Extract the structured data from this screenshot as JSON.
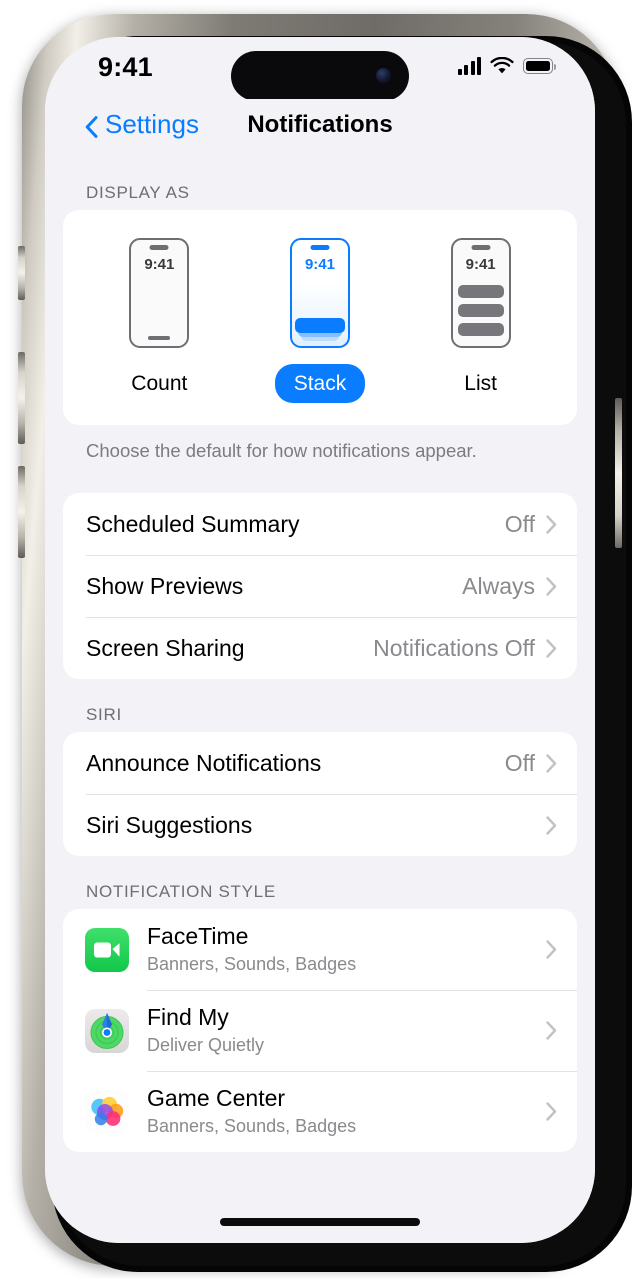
{
  "statusbar": {
    "time": "9:41",
    "cellular_icon": "cellular-signal-icon",
    "wifi_icon": "wifi-icon",
    "battery_icon": "battery-icon"
  },
  "navbar": {
    "back_label": "Settings",
    "back_icon": "chevron-left-icon",
    "title": "Notifications"
  },
  "display_as": {
    "header": "DISPLAY AS",
    "footer": "Choose the default for how notifications appear.",
    "options": [
      {
        "label": "Count",
        "preview_time": "9:41",
        "selected": false
      },
      {
        "label": "Stack",
        "preview_time": "9:41",
        "selected": true
      },
      {
        "label": "List",
        "preview_time": "9:41",
        "selected": false
      }
    ]
  },
  "general": {
    "rows": [
      {
        "label": "Scheduled Summary",
        "value": "Off"
      },
      {
        "label": "Show Previews",
        "value": "Always"
      },
      {
        "label": "Screen Sharing",
        "value": "Notifications Off"
      }
    ]
  },
  "siri": {
    "header": "SIRI",
    "rows": [
      {
        "label": "Announce Notifications",
        "value": "Off"
      },
      {
        "label": "Siri Suggestions",
        "value": ""
      }
    ]
  },
  "notification_style": {
    "header": "NOTIFICATION STYLE",
    "apps": [
      {
        "name": "FaceTime",
        "detail": "Banners, Sounds, Badges",
        "icon": "facetime-icon"
      },
      {
        "name": "Find My",
        "detail": "Deliver Quietly",
        "icon": "findmy-icon"
      },
      {
        "name": "Game Center",
        "detail": "Banners, Sounds, Badges",
        "icon": "gamecenter-icon"
      }
    ]
  },
  "colors": {
    "accent_blue": "#0a7cff",
    "background": "#f2f2f7",
    "card": "#ffffff",
    "secondary_text": "#8a8a8e",
    "facetime_green": "#12c74a"
  }
}
